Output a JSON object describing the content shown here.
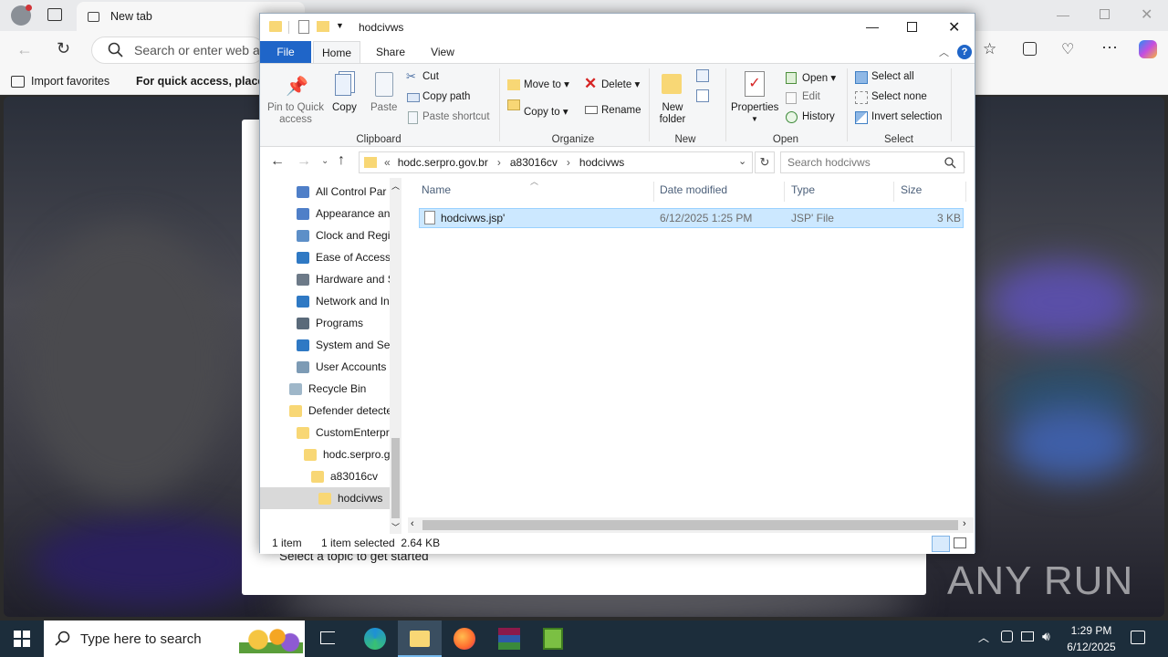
{
  "browser": {
    "tab_title": "New tab",
    "address_placeholder": "Search or enter web a",
    "favorites": [
      "Import favorites",
      "For quick access, place y"
    ],
    "page_text": "Select a topic to get started"
  },
  "explorer": {
    "title": "hodcivws",
    "menu_tabs": {
      "file": "File",
      "home": "Home",
      "share": "Share",
      "view": "View"
    },
    "ribbon": {
      "clipboard": {
        "pin": "Pin to Quick access",
        "copy": "Copy",
        "paste": "Paste",
        "cut": "Cut",
        "copy_path": "Copy path",
        "paste_shortcut": "Paste shortcut",
        "group": "Clipboard"
      },
      "organize": {
        "move_to": "Move to",
        "copy_to": "Copy to",
        "delete": "Delete",
        "rename": "Rename",
        "group": "Organize"
      },
      "new": {
        "new_folder": "New folder",
        "group": "New"
      },
      "open": {
        "properties": "Properties",
        "open": "Open",
        "edit": "Edit",
        "history": "History",
        "group": "Open"
      },
      "select": {
        "select_all": "Select all",
        "select_none": "Select none",
        "invert": "Invert selection",
        "group": "Select"
      }
    },
    "breadcrumb": {
      "overflow": "«",
      "parts": [
        "hodc.serpro.gov.br",
        "a83016cv",
        "hodcivws"
      ]
    },
    "search_placeholder": "Search hodcivws",
    "nav": [
      {
        "label": "All Control Par",
        "icon": "control-panel-icon"
      },
      {
        "label": "Appearance an",
        "icon": "appearance-icon"
      },
      {
        "label": "Clock and Regi",
        "icon": "clock-icon"
      },
      {
        "label": "Ease of Access",
        "icon": "ease-of-access-icon"
      },
      {
        "label": "Hardware and S",
        "icon": "hardware-icon"
      },
      {
        "label": "Network and In",
        "icon": "network-icon"
      },
      {
        "label": "Programs",
        "icon": "programs-icon"
      },
      {
        "label": "System and Sec",
        "icon": "security-shield-icon"
      },
      {
        "label": "User Accounts",
        "icon": "user-accounts-icon"
      },
      {
        "label": "Recycle Bin",
        "icon": "recycle-bin-icon"
      },
      {
        "label": "Defender detecte",
        "icon": "folder-icon"
      },
      {
        "label": "CustomEnterpr",
        "icon": "folder-icon"
      },
      {
        "label": "hodc.serpro.g",
        "icon": "folder-icon"
      },
      {
        "label": "a83016cv",
        "icon": "folder-icon"
      },
      {
        "label": "hodcivws",
        "icon": "folder-icon"
      }
    ],
    "columns": {
      "name": "Name",
      "date": "Date modified",
      "type": "Type",
      "size": "Size"
    },
    "files": [
      {
        "name": "hodcivws.jsp'",
        "date": "6/12/2025 1:25 PM",
        "type": "JSP' File",
        "size": "3 KB"
      }
    ],
    "status": {
      "count": "1 item",
      "selected": "1 item selected  2.64 KB"
    }
  },
  "taskbar": {
    "search_placeholder": "Type here to search",
    "time": "1:29 PM",
    "date": "6/12/2025"
  },
  "watermark": "ANY RUN"
}
